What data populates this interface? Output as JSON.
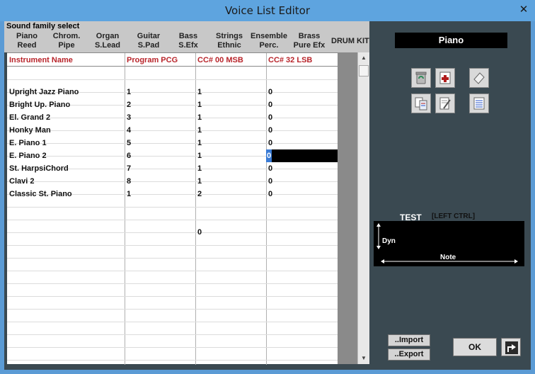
{
  "window": {
    "title": "Voice List Editor",
    "close_glyph": "✕"
  },
  "family_select": {
    "title": "Sound family select",
    "families": [
      {
        "line1": "Piano",
        "line2": "Reed"
      },
      {
        "line1": "Chrom.",
        "line2": "Pipe"
      },
      {
        "line1": "Organ",
        "line2": "S.Lead"
      },
      {
        "line1": "Guitar",
        "line2": "S.Pad"
      },
      {
        "line1": "Bass",
        "line2": "S.Efx"
      },
      {
        "line1": "Strings",
        "line2": "Ethnic"
      },
      {
        "line1": "Ensemble",
        "line2": "Perc."
      },
      {
        "line1": "Brass",
        "line2": "Pure Efx"
      }
    ],
    "drum_kit": "DRUM KIT"
  },
  "table": {
    "headers": [
      "Instrument Name",
      "Program PCG",
      "CC# 00  MSB",
      "CC# 32  LSB"
    ],
    "rows": [
      [
        "Upright Jazz Piano",
        "1",
        "1",
        "0"
      ],
      [
        "Bright Up. Piano",
        "2",
        "1",
        "0"
      ],
      [
        "El. Grand 2",
        "3",
        "1",
        "0"
      ],
      [
        "Honky Man",
        "4",
        "1",
        "0"
      ],
      [
        "E. Piano 1",
        "5",
        "1",
        "0"
      ],
      [
        "E. Piano 2",
        "6",
        "1",
        "0"
      ],
      [
        "St. HarpsiChord",
        "7",
        "1",
        "0"
      ],
      [
        "Clavi 2",
        "8",
        "1",
        "0"
      ],
      [
        "Classic St. Piano",
        "1",
        "2",
        "0"
      ]
    ],
    "stray_value": "0"
  },
  "scrollbar": {
    "up_glyph": "▲",
    "down_glyph": "▼"
  },
  "voice_name": "Piano",
  "toolbar_icons": [
    "recycle-bin-icon",
    "add-document-icon",
    "eraser-icon",
    "copy-paste-icon",
    "edit-document-icon",
    "document-icon"
  ],
  "test_panel": {
    "label": "TEST",
    "modifier": "[LEFT CTRL]",
    "y_axis": "Dyn",
    "x_axis": "Note"
  },
  "buttons": {
    "import": "..Import",
    "export": "..Export",
    "ok": "OK"
  },
  "colors": {
    "titlebar": "#5ea4df",
    "client": "#3a4951",
    "header_text": "#b8242a",
    "selection": "#3a7bd5"
  }
}
